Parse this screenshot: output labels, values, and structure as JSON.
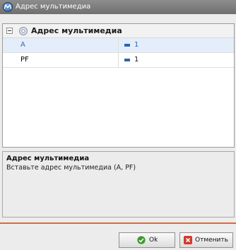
{
  "window": {
    "title": "Адрес мультимедиа"
  },
  "property_grid": {
    "group_title": "Адрес мультимедиа",
    "rows": [
      {
        "name": "A",
        "value": "1",
        "selected": true
      },
      {
        "name": "PF",
        "value": "1",
        "selected": false
      }
    ]
  },
  "description": {
    "title": "Адрес мультимедиа",
    "text": "Вставьте адрес мультимедиа (A, PF)"
  },
  "buttons": {
    "ok_label": "Ok",
    "cancel_label": "Отменить"
  },
  "colors": {
    "accent": "#e4663a",
    "selected_row": "#e4eefa",
    "value_blue": "#2f63b0"
  },
  "icons": {
    "app": "multimedia-app-icon",
    "group": "gear-icon",
    "ok": "checkmark-icon",
    "cancel": "close-x-icon"
  }
}
